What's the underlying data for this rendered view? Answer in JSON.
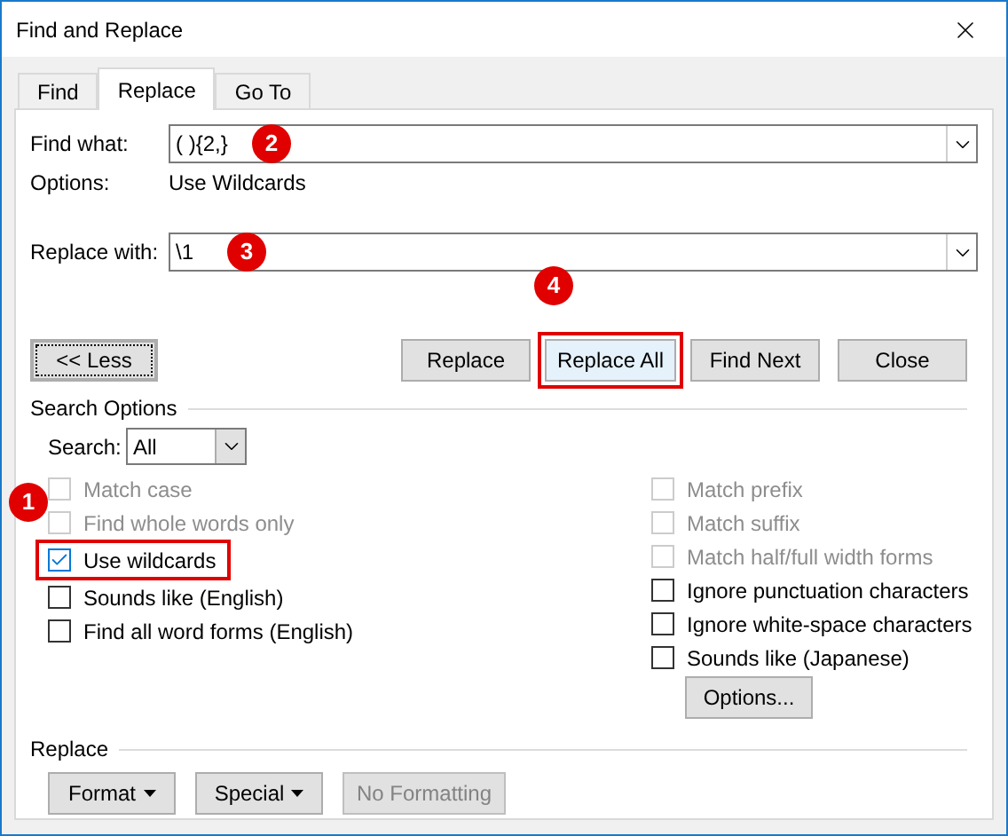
{
  "window": {
    "title": "Find and Replace"
  },
  "tabs": [
    {
      "label": "Find",
      "selected": false
    },
    {
      "label": "Replace",
      "selected": true
    },
    {
      "label": "Go To",
      "selected": false
    }
  ],
  "find_what": {
    "label": "Find what:",
    "value": "( ){2,}",
    "callout": "2"
  },
  "options": {
    "label": "Options:",
    "value": "Use Wildcards"
  },
  "replace_with": {
    "label": "Replace with:",
    "value": "\\1",
    "callout": "3"
  },
  "less_button": {
    "label": "<< Less",
    "focused": true
  },
  "action_buttons": [
    {
      "label": "Replace",
      "highlighted": false
    },
    {
      "label": "Replace All",
      "highlighted": true,
      "callout": "4"
    },
    {
      "label": "Find Next",
      "highlighted": false
    },
    {
      "label": "Close",
      "highlighted": false
    }
  ],
  "search_options": {
    "heading": "Search Options",
    "search_label": "Search:",
    "search_value": "All"
  },
  "left_checkboxes": [
    {
      "label": "Match case",
      "checked": false,
      "disabled": true
    },
    {
      "label": "Find whole words only",
      "checked": false,
      "disabled": true
    },
    {
      "label": "Use wildcards",
      "checked": true,
      "disabled": false,
      "highlighted": true,
      "callout": "1"
    },
    {
      "label": "Sounds like (English)",
      "checked": false,
      "disabled": false
    },
    {
      "label": "Find all word forms (English)",
      "checked": false,
      "disabled": false
    }
  ],
  "right_checkboxes": [
    {
      "label": "Match prefix",
      "checked": false,
      "disabled": true
    },
    {
      "label": "Match suffix",
      "checked": false,
      "disabled": true
    },
    {
      "label": "Match half/full width forms",
      "checked": false,
      "disabled": true
    },
    {
      "label": "Ignore punctuation characters",
      "checked": false,
      "disabled": false
    },
    {
      "label": "Ignore white-space characters",
      "checked": false,
      "disabled": false
    },
    {
      "label": "Sounds like (Japanese)",
      "checked": false,
      "disabled": false
    }
  ],
  "options_button": {
    "label": "Options..."
  },
  "replace_section": {
    "heading": "Replace",
    "buttons": [
      {
        "label": "Format",
        "kind": "dropdown",
        "disabled": false
      },
      {
        "label": "Special",
        "kind": "dropdown",
        "disabled": false
      },
      {
        "label": "No Formatting",
        "kind": "plain",
        "disabled": true
      }
    ]
  }
}
